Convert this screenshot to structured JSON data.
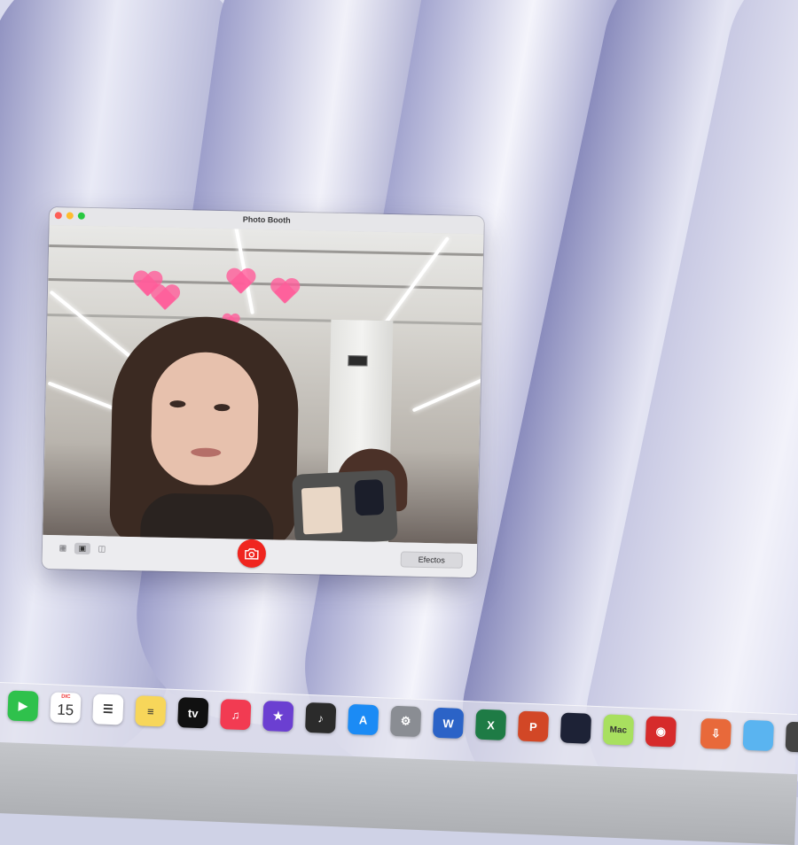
{
  "window": {
    "title": "Photo Booth",
    "effects_label": "Efectos"
  },
  "modes": [
    {
      "name": "grid-mode",
      "icon": "grid-icon",
      "glyph": "▦",
      "active": false
    },
    {
      "name": "single-photo-mode",
      "icon": "portrait-icon",
      "glyph": "▣",
      "active": true
    },
    {
      "name": "video-mode",
      "icon": "video-camera-icon",
      "glyph": "◫",
      "active": false
    }
  ],
  "dock": {
    "calendar": {
      "month": "DIC",
      "day": "15"
    },
    "apps": [
      {
        "name": "facetime",
        "icon": "facetime-icon",
        "glyph": "▶",
        "color": "#2fc14c"
      },
      {
        "name": "calendar",
        "icon": "calendar-icon",
        "glyph": "",
        "color": "#ffffff"
      },
      {
        "name": "reminders",
        "icon": "reminders-icon",
        "glyph": "☰",
        "color": "#ffffff"
      },
      {
        "name": "notes",
        "icon": "notes-icon",
        "glyph": "≡",
        "color": "#f7d65a"
      },
      {
        "name": "apple-tv",
        "icon": "apple-tv-icon",
        "glyph": "tv",
        "color": "#111111"
      },
      {
        "name": "music",
        "icon": "music-icon",
        "glyph": "♫",
        "color": "#f23b52"
      },
      {
        "name": "imovie",
        "icon": "imovie-icon",
        "glyph": "★",
        "color": "#6b3fd1"
      },
      {
        "name": "garageband",
        "icon": "garageband-icon",
        "glyph": "♪",
        "color": "#2b2b2b"
      },
      {
        "name": "app-store",
        "icon": "app-store-icon",
        "glyph": "A",
        "color": "#1b8bf5"
      },
      {
        "name": "system-settings",
        "icon": "gear-icon",
        "glyph": "⚙",
        "color": "#8a8d93"
      },
      {
        "name": "word",
        "icon": "word-icon",
        "glyph": "W",
        "color": "#2b63c7"
      },
      {
        "name": "excel",
        "icon": "excel-icon",
        "glyph": "X",
        "color": "#1e7b45"
      },
      {
        "name": "powerpoint",
        "icon": "powerpoint-icon",
        "glyph": "P",
        "color": "#d24726"
      },
      {
        "name": "legends-game",
        "icon": "legends-game-icon",
        "glyph": "",
        "color": "#1d2236"
      },
      {
        "name": "mac-app",
        "icon": "mac-icon",
        "glyph": "Mac",
        "color": "#a8e05f"
      },
      {
        "name": "photo-booth",
        "icon": "photo-booth-icon",
        "glyph": "◉",
        "color": "#d62b2b"
      },
      {
        "name": "downloads-stack",
        "icon": "download-icon",
        "glyph": "⇩",
        "color": "#e8693a"
      },
      {
        "name": "folder",
        "icon": "folder-icon",
        "glyph": "",
        "color": "#5ab4f0"
      },
      {
        "name": "trash",
        "icon": "trash-icon",
        "glyph": "",
        "color": "#444444"
      }
    ]
  }
}
